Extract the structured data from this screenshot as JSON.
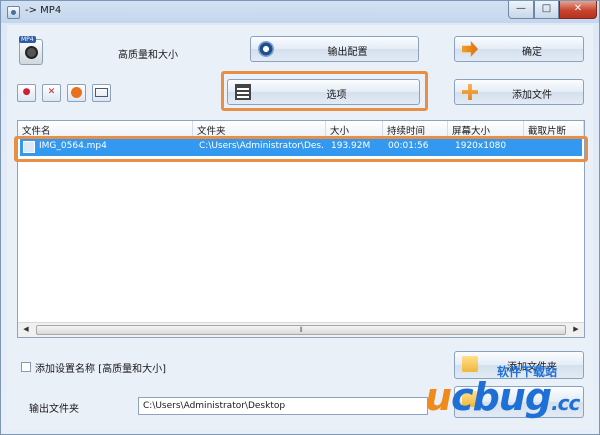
{
  "window": {
    "title": "-> MP4",
    "controls": {
      "minimize": "—",
      "maximize": "□",
      "close": "✕"
    }
  },
  "profile": {
    "icon_tag": "MP4",
    "name": "高质量和大小"
  },
  "buttons": {
    "output_config": "输出配置",
    "ok": "确定",
    "options": "选项",
    "add_file": "添加文件",
    "add_folder": "添加文件夹"
  },
  "tools": [
    {
      "icon": "new-icon",
      "glyph": "●"
    },
    {
      "icon": "delete-icon",
      "glyph": "✕"
    },
    {
      "icon": "play-icon",
      "glyph": ""
    },
    {
      "icon": "media-info-icon",
      "glyph": ""
    }
  ],
  "table": {
    "columns": [
      "文件名",
      "文件夹",
      "大小",
      "持续时间",
      "屏幕大小",
      "截取片断"
    ],
    "rows": [
      {
        "name": "IMG_0564.mp4",
        "folder": "C:\\Users\\Administrator\\Des...",
        "size": "193.92M",
        "duration": "00:01:56",
        "screen": "1920x1080",
        "clip": ""
      }
    ],
    "scroll_arrows": {
      "left": "◀",
      "right": "▶"
    },
    "scroll_grip": "⦀"
  },
  "bottom": {
    "add_setting_label": "添加设置名称 [高质量和大小]",
    "add_setting_checked": false,
    "output_folder_label": "输出文件夹",
    "output_folder_value": "C:\\Users\\Administrator\\Desktop"
  },
  "watermark": {
    "logo_u": "u",
    "logo_c": "c",
    "logo_bug": "bug",
    "logo_dot": ".cc",
    "subtitle": "软件下载站"
  },
  "colors": {
    "selection": "#3398ef",
    "highlight": "#e98e45",
    "close_button": "#c7452f"
  }
}
